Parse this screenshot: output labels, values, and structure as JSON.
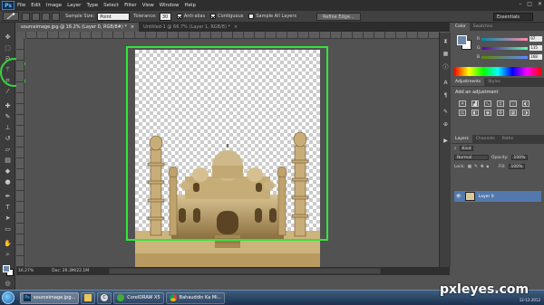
{
  "app": {
    "logo": "Ps",
    "window_controls": [
      "–",
      "□",
      "✕"
    ]
  },
  "menu": [
    "File",
    "Edit",
    "Image",
    "Layer",
    "Type",
    "Select",
    "Filter",
    "View",
    "Window",
    "Help"
  ],
  "options": {
    "sample_size_label": "Sample Size:",
    "sample_size_value": "Point Sample",
    "tolerance_label": "Tolerance:",
    "tolerance_value": "30",
    "anti_alias_label": "Anti-alias",
    "contiguous_label": "Contiguous",
    "sample_all_layers_label": "Sample All Layers",
    "refine_edge_label": "Refine Edge...",
    "workspace": "Essentials"
  },
  "tabs": [
    {
      "label": "sourceimage.jpg @ 16.2% (Layer 0, RGB/8#) *",
      "close": "×"
    },
    {
      "label": "Untitled-1 @ 66.7% (Layer 1, RGB/8) *",
      "close": "×"
    }
  ],
  "status": {
    "zoom": "16.27%",
    "doc": "Doc: 26.3M/22.1M"
  },
  "panels": {
    "color_tabs": [
      "Color",
      "Swatches"
    ],
    "color_values": [
      {
        "channel": "R",
        "value": "97"
      },
      {
        "channel": "G",
        "value": "135"
      },
      {
        "channel": "B",
        "value": "168"
      }
    ],
    "adj_tabs": [
      "Adjustments",
      "Styles"
    ],
    "adj_title": "Add an adjustment",
    "layers_tabs": [
      "Layers",
      "Channels",
      "Paths"
    ],
    "kind_label": "Kind",
    "blend_mode": "Normal",
    "opacity_label": "Opacity:",
    "opacity_value": "100%",
    "lock_label": "Lock:",
    "fill_label": "Fill:",
    "fill_value": "100%",
    "layer_name": "Layer 0"
  },
  "taskbar": {
    "items": [
      "sourceimage.jpg...",
      "",
      "",
      "CorelDRAW X5",
      "Bahauddin Ka Mi..."
    ],
    "clock": "12-12-2012"
  },
  "watermark": "pxleyes.com",
  "colors": {
    "selection_highlight": "#2ee838",
    "foreground": "#6f89a8"
  }
}
